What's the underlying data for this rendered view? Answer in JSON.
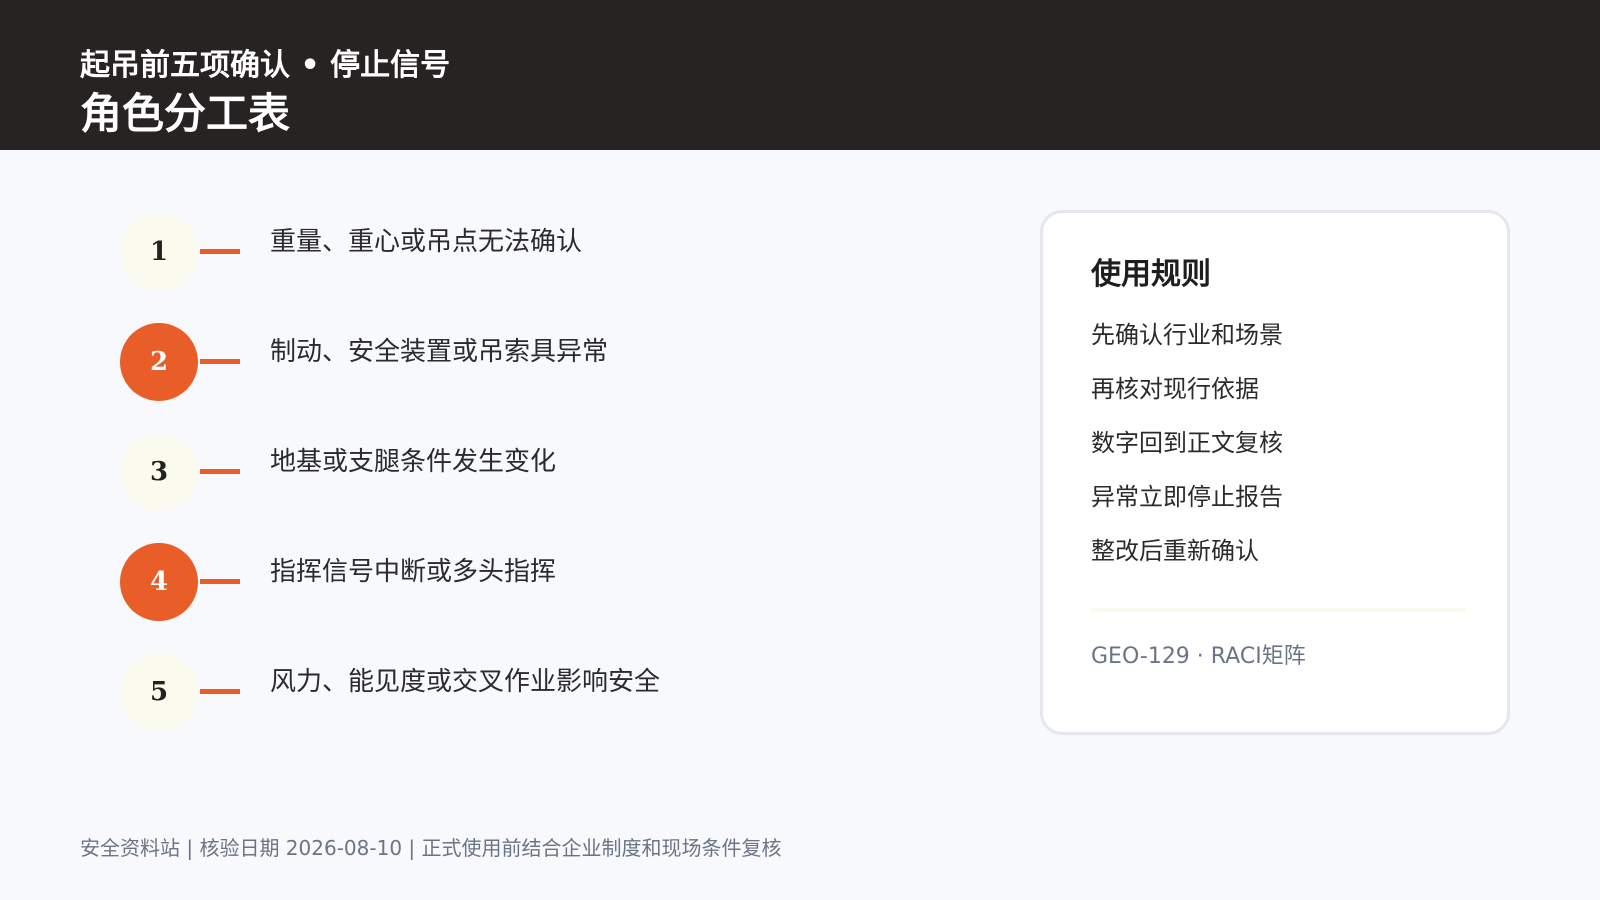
{
  "header": {
    "subtitle": "起吊前五项确认 • 停止信号",
    "title": "角色分工表"
  },
  "checklist": [
    {
      "number": "1",
      "label": "重量、重心或吊点无法确认",
      "highlight": false
    },
    {
      "number": "2",
      "label": "制动、安全装置或吊索具异常",
      "highlight": true
    },
    {
      "number": "3",
      "label": "地基或支腿条件发生变化",
      "highlight": false
    },
    {
      "number": "4",
      "label": "指挥信号中断或多头指挥",
      "highlight": true
    },
    {
      "number": "5",
      "label": "风力、能见度或交叉作业影响安全",
      "highlight": false
    }
  ],
  "rules_card": {
    "title": "使用规则",
    "rules": [
      "先确认行业和场景",
      "再核对现行依据",
      "数字回到正文复核",
      "异常立即停止报告",
      "整改后重新确认"
    ],
    "code": "GEO-129 · RACI矩阵"
  },
  "footer": "安全资料站 | 核验日期 2026-08-10 | 正式使用前结合企业制度和现场条件复核",
  "colors": {
    "header_bg": "#262322",
    "accent": "#e85d28",
    "circle_light": "#fbfaef",
    "page_bg": "#f7f9fc"
  }
}
